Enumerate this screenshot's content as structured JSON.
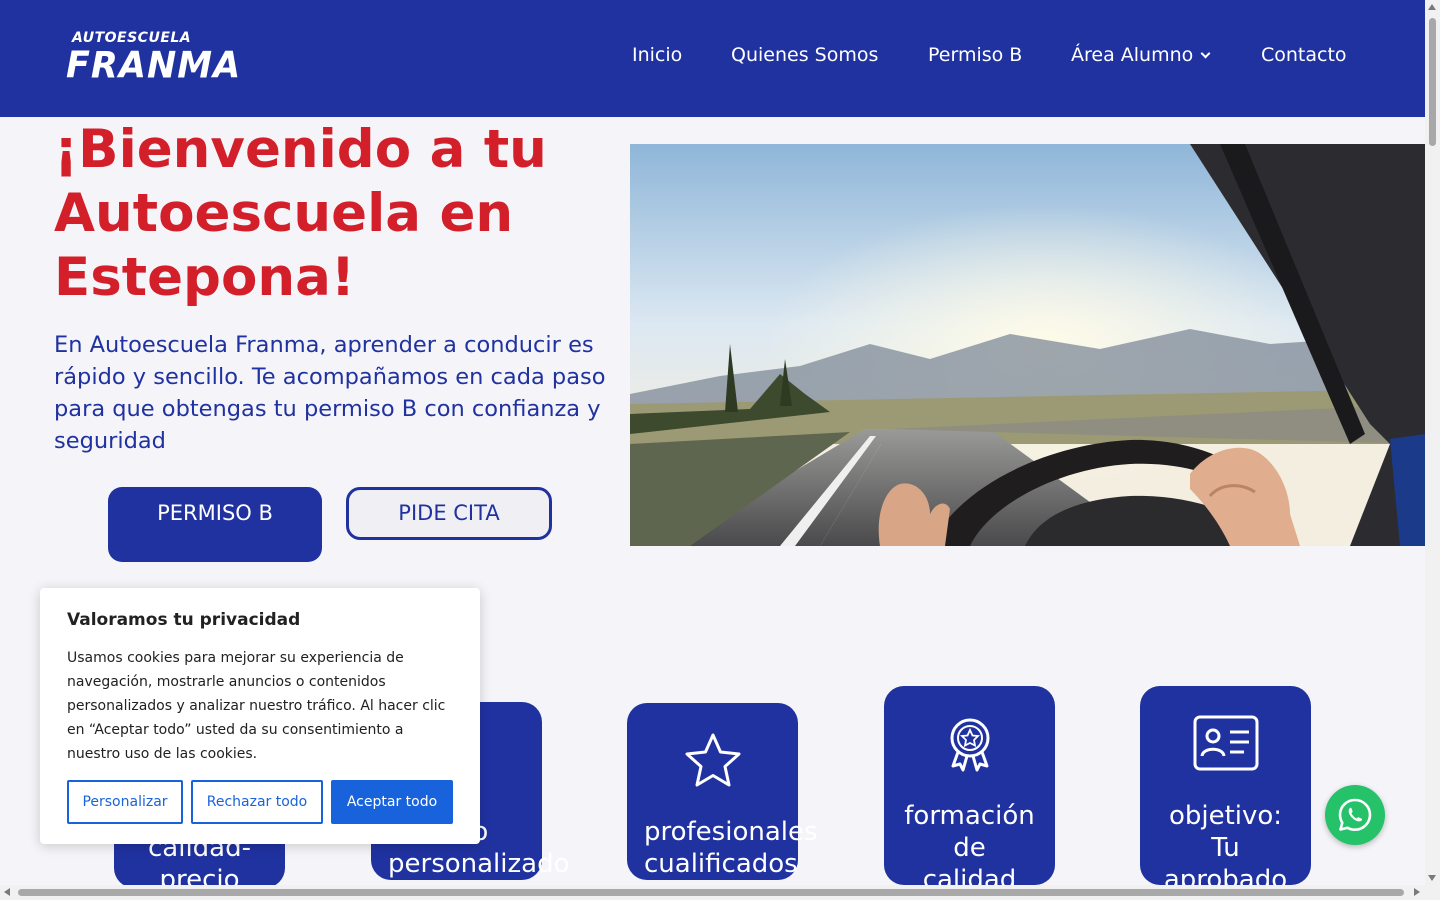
{
  "brand": {
    "logo_top": "AUTOESCUELA",
    "logo_main": "FRANMA",
    "primary_color": "#2032a0",
    "accent_color": "#d21f2a"
  },
  "nav": {
    "items": [
      {
        "label": "Inicio"
      },
      {
        "label": "Quienes Somos"
      },
      {
        "label": "Permiso B"
      },
      {
        "label": "Área Alumno"
      },
      {
        "label": "Contacto"
      }
    ]
  },
  "hero": {
    "title": "¡Bienvenido a tu Autoescuela en Estepona!",
    "text": "En Autoescuela Franma, aprender a conducir es rápido y sencillo. Te acompañamos en cada paso para que obtengas tu permiso B con confianza y seguridad",
    "btn_primary": "PERMISO B",
    "btn_secondary": "PIDE CITA"
  },
  "features": {
    "cards": [
      {
        "label_line1": "calidad-",
        "label_line2": "precio",
        "icon": "price-icon"
      },
      {
        "label_line1": "servicio",
        "label_line2": "personalizado",
        "icon": "sliders-icon"
      },
      {
        "label_line1": "profesionales",
        "label_line2": "cualificados",
        "icon": "star-icon"
      },
      {
        "label_line1": "formación",
        "label_line2": "de",
        "label_line3": "calidad",
        "icon": "award-icon"
      },
      {
        "label_line1": "objetivo:",
        "label_line2": "Tu",
        "label_line3": "aprobado",
        "icon": "id-card-icon"
      }
    ]
  },
  "cookie": {
    "title": "Valoramos tu privacidad",
    "text": "Usamos cookies para mejorar su experiencia de navegación, mostrarle anuncios o contenidos personalizados y analizar nuestro tráfico. Al hacer clic en “Aceptar todo” usted da su consentimiento a nuestro uso de las cookies.",
    "btn_customize": "Personalizar",
    "btn_reject": "Rechazar todo",
    "btn_accept": "Aceptar todo",
    "button_color": "#1863dc"
  },
  "whatsapp": {
    "icon": "whatsapp-icon",
    "color": "#25c26a"
  }
}
